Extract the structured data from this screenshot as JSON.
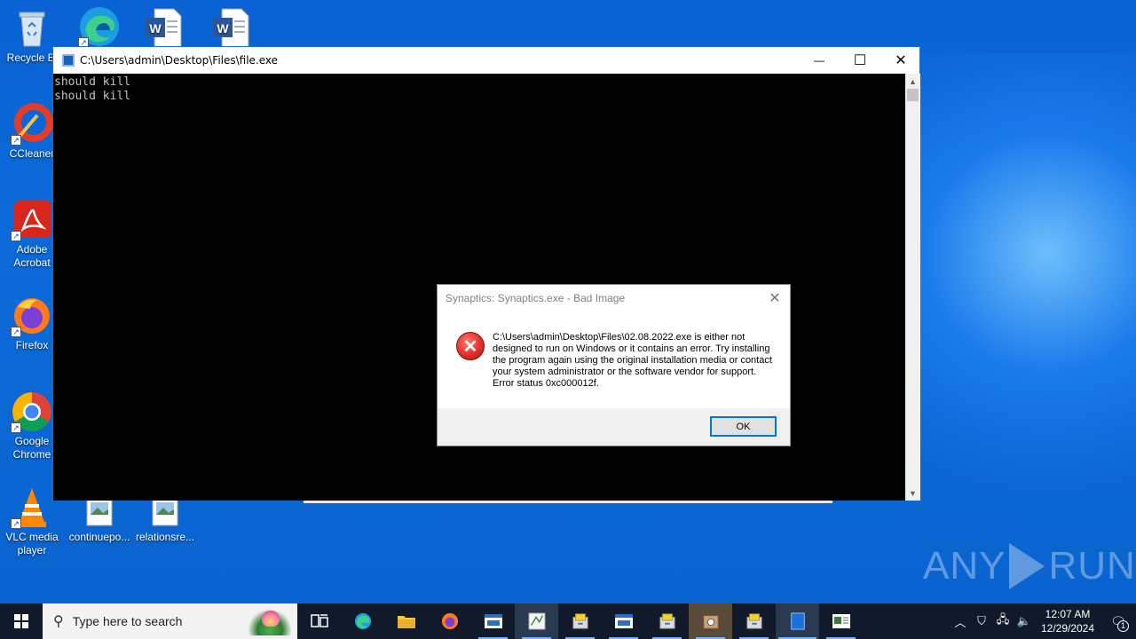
{
  "desktop": {
    "icons": [
      {
        "label": "Recycle Bin",
        "name": "recycle-bin"
      },
      {
        "label": "CCleaner",
        "name": "ccleaner"
      },
      {
        "label": "Adobe Acrobat",
        "name": "adobe-acrobat"
      },
      {
        "label": "Firefox",
        "name": "firefox"
      },
      {
        "label": "Google Chrome",
        "name": "google-chrome"
      },
      {
        "label": "VLC media player",
        "name": "vlc-media-player"
      },
      {
        "label": "continuepo...",
        "name": "continuepo-file"
      },
      {
        "label": "relationsre...",
        "name": "relationsre-file"
      }
    ],
    "recycle_label": "Recycle Bi",
    "ccleaner_label": "CCleaner",
    "acrobat_label": "Adobe Acrobat",
    "firefox_label": "Firefox",
    "chrome_label": "Google Chrome",
    "vlc_label": "VLC media player",
    "file1_label": "continuepo...",
    "file2_label": "relationsre..."
  },
  "console": {
    "title": "C:\\Users\\admin\\Desktop\\Files\\file.exe",
    "lines": [
      "should kill",
      "should kill"
    ],
    "minimize_glyph": "—",
    "maximize_glyph": "☐",
    "close_glyph": "✕"
  },
  "dialog": {
    "title": "Synaptics: Synaptics.exe - Bad Image",
    "message": "C:\\Users\\admin\\Desktop\\Files\\02.08.2022.exe is either not designed to run on Windows or it contains an error. Try installing the program again using the original installation media or contact your system administrator or the software vendor for support. Error status 0xc000012f.",
    "ok_label": "OK",
    "close_glyph": "✕",
    "icon": "error-icon"
  },
  "watermark": {
    "left": "ANY",
    "right": "RUN"
  },
  "taskbar": {
    "search_placeholder": "Type here to search",
    "apps": [
      "task-view",
      "edge",
      "file-explorer",
      "firefox",
      "app-window",
      "paint",
      "installer",
      "app-window-2",
      "installer-2",
      "setup",
      "installer-3",
      "console",
      "app-window-3"
    ],
    "time": "12:07 AM",
    "date": "12/29/2024",
    "notification_count": "1"
  },
  "colors": {
    "accent": "#0078d7",
    "taskbar": "#101a2a",
    "console_bg": "#000000",
    "error_red": "#e0302a"
  }
}
